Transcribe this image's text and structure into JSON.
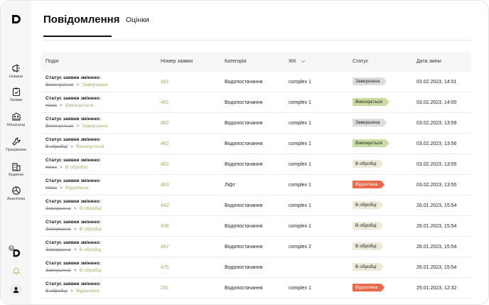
{
  "sidebar": {
    "items": [
      {
        "label": "Новини",
        "icon": "megaphone-icon"
      },
      {
        "label": "Заявки",
        "icon": "clipboard-icon"
      },
      {
        "label": "Мешканці",
        "icon": "residents-icon"
      },
      {
        "label": "Працівники",
        "icon": "wrench-icon"
      },
      {
        "label": "Будинки",
        "icon": "building-icon"
      },
      {
        "label": "Аналітика",
        "icon": "pie-chart-icon"
      }
    ],
    "notif_count": "4"
  },
  "tabs": {
    "active": "Повідомлення",
    "other": "Оцінки"
  },
  "table": {
    "headers": {
      "event": "Подія",
      "number": "Номер заявки",
      "category": "Категорія",
      "zk": "ЖК",
      "status": "Статус",
      "date": "Дата зміни"
    },
    "rows": [
      {
        "title": "Статус заявки змінено:",
        "old": "Виконується",
        "new": "Завершена",
        "number": "481",
        "category": "Водопостачання",
        "zk": "complex 1",
        "status": "Завершена",
        "status_type": "done",
        "date": "03.02.2023, 14:01"
      },
      {
        "title": "Статус заявки змінено:",
        "old": "Нова",
        "new": "Виконується",
        "number": "481",
        "category": "Водопостачання",
        "zk": "complex 1",
        "status": "Виконується",
        "status_type": "prog",
        "date": "03.02.2023, 14:00"
      },
      {
        "title": "Статус заявки змінено:",
        "old": "Виконується",
        "new": "Завершена",
        "number": "482",
        "category": "Водопостачання",
        "zk": "complex 1",
        "status": "Завершена",
        "status_type": "done",
        "date": "03.02.2023, 13:59"
      },
      {
        "title": "Статус заявки змінено:",
        "old": "В обробці",
        "new": "Виконується",
        "number": "482",
        "category": "Водопостачання",
        "zk": "complex 1",
        "status": "Виконується",
        "status_type": "prog",
        "date": "03.02.2023, 13:56"
      },
      {
        "title": "Статус заявки змінено:",
        "old": "Нова",
        "new": "В обробці",
        "number": "482",
        "category": "Водопостачання",
        "zk": "complex 1",
        "status": "В обробці",
        "status_type": "proc",
        "date": "03.02.2023, 13:55"
      },
      {
        "title": "Статус заявки змінено:",
        "old": "Нова",
        "new": "Відхилена",
        "number": "483",
        "category": "Ліфт",
        "zk": "complex 1",
        "status": "Відхилена",
        "status_type": "rej",
        "date": "03.02.2023, 13:55"
      },
      {
        "title": "Статус заявки змінено:",
        "old": "Завершена",
        "new": "В обробці",
        "number": "442",
        "category": "Водопостачання",
        "zk": "complex 1",
        "status": "В обробці",
        "status_type": "proc",
        "date": "26.01.2023, 15:54"
      },
      {
        "title": "Статус заявки змінено:",
        "old": "Завершена",
        "new": "В обробці",
        "number": "438",
        "category": "Водопостачання",
        "zk": "complex 1",
        "status": "В обробці",
        "status_type": "proc",
        "date": "26.01.2023, 15:54"
      },
      {
        "title": "Статус заявки змінено:",
        "old": "Завершена",
        "new": "В обробці",
        "number": "467",
        "category": "Водопостачання",
        "zk": "complex 2",
        "status": "В обробці",
        "status_type": "proc",
        "date": "26.01.2023, 15:54"
      },
      {
        "title": "Статус заявки змінено:",
        "old": "Завершена",
        "new": "В обробці",
        "number": "475",
        "category": "Водопостачання",
        "zk": "",
        "status": "В обробці",
        "status_type": "proc",
        "date": "26.01.2023, 15:54"
      },
      {
        "title": "Статус заявки змінено:",
        "old": "В обробці",
        "new": "Відхилена",
        "number": "241",
        "category": "Водопостачання",
        "zk": "complex 1",
        "status": "Відхилена",
        "status_type": "rej",
        "date": "25.01.2023, 12:32"
      }
    ]
  }
}
